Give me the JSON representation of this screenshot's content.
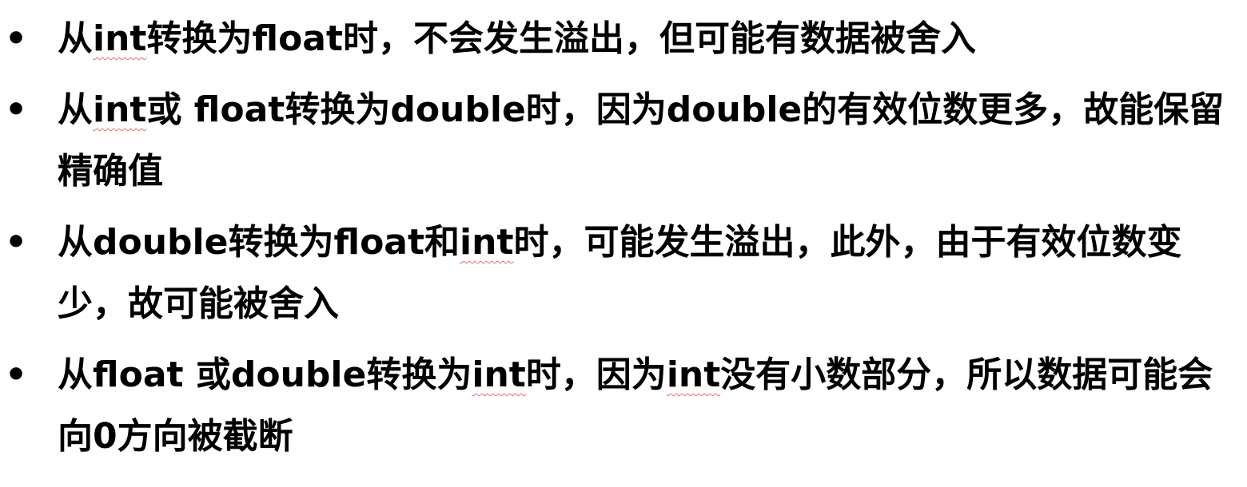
{
  "bullets": [
    {
      "marker": "•",
      "parts": [
        "从",
        "int",
        "转换为float时，不会发生溢出，但可能有数据被舍入"
      ]
    },
    {
      "marker": "•",
      "parts": [
        "从",
        "int",
        "或 float转换为double时，因为double的有效位数更多，故能保留精确值"
      ]
    },
    {
      "marker": "•",
      "parts": [
        "从double转换为float和",
        "int",
        "时，可能发生溢出，此外，由于有效位数变少，故可能被舍入"
      ]
    },
    {
      "marker": "•",
      "parts": [
        "从float 或double转换为",
        "int",
        "时，因为",
        "int",
        "没有小数部分，所以数据可能会向0方向被截断"
      ]
    }
  ]
}
